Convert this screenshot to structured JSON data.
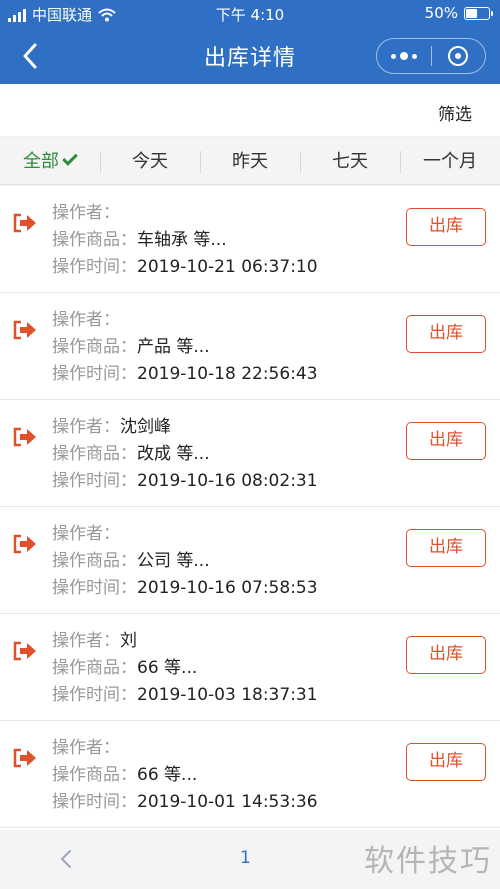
{
  "status_bar": {
    "carrier": "中国联通",
    "time": "下午 4:10",
    "battery": "50%",
    "battery_level": 0.5
  },
  "nav": {
    "title": "出库详情",
    "back_icon": "chevron-left-icon",
    "more_icon": "more-dots-icon",
    "close_icon": "target-circle-icon"
  },
  "filter": {
    "label": "筛选"
  },
  "tabs": [
    {
      "label": "全部",
      "active": true
    },
    {
      "label": "今天",
      "active": false
    },
    {
      "label": "昨天",
      "active": false
    },
    {
      "label": "七天",
      "active": false
    },
    {
      "label": "一个月",
      "active": false
    }
  ],
  "labels": {
    "operator": "操作者：",
    "goods": "操作商品：",
    "time": "操作时间：",
    "action": "出库"
  },
  "records": [
    {
      "operator": "",
      "goods": "车轴承 等...",
      "time": "2019-10-21 06:37:10"
    },
    {
      "operator": "",
      "goods": "产品 等...",
      "time": "2019-10-18 22:56:43"
    },
    {
      "operator": "沈剑峰",
      "goods": "改成 等...",
      "time": "2019-10-16 08:02:31"
    },
    {
      "operator": "",
      "goods": "公司 等...",
      "time": "2019-10-16 07:58:53"
    },
    {
      "operator": "刘",
      "goods": "66 等...",
      "time": "2019-10-03 18:37:31"
    },
    {
      "operator": "",
      "goods": "66 等...",
      "time": "2019-10-01 14:53:36"
    }
  ],
  "pager": {
    "page": "1"
  },
  "watermark": "软件技巧",
  "colors": {
    "primary": "#2f6fc4",
    "active_tab": "#2e8b3a",
    "action": "#e0502a"
  }
}
